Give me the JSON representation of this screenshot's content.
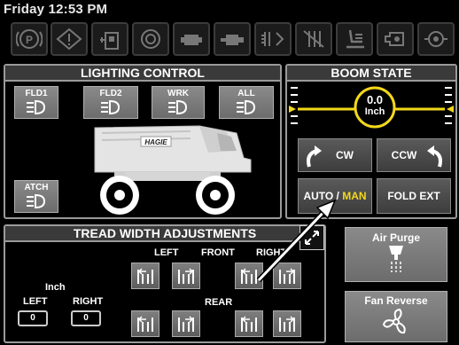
{
  "status": {
    "datetime": "Friday 12:53 PM"
  },
  "indicators": [
    {
      "icon": "parking-brake-icon",
      "label": "(P)"
    },
    {
      "icon": "warning-icon",
      "label": "!"
    },
    {
      "icon": "fuel-tank-icon"
    },
    {
      "icon": "engine-oil-icon"
    },
    {
      "icon": "battery-icon"
    },
    {
      "icon": "oil-can-icon"
    },
    {
      "icon": "heater-icon"
    },
    {
      "icon": "filter-restriction-icon"
    },
    {
      "icon": "seat-icon"
    },
    {
      "icon": "pump-icon"
    },
    {
      "icon": "hydraulic-icon"
    }
  ],
  "lighting": {
    "title": "LIGHTING CONTROL",
    "buttons": {
      "fld1": "FLD1",
      "fld2": "FLD2",
      "wrk": "WRK",
      "all": "ALL",
      "atch": "ATCH"
    },
    "machine_badge": "HAGIE"
  },
  "boom": {
    "title": "BOOM STATE",
    "value": "0.0",
    "unit": "Inch",
    "cw": "CW",
    "ccw": "CCW",
    "auto": "AUTO",
    "separator": " / ",
    "man": "MAN",
    "fold_ext": "FOLD EXT"
  },
  "tread": {
    "title": "TREAD WIDTH ADJUSTMENTS",
    "left_head": "LEFT",
    "front": "FRONT",
    "right_head": "RIGHT",
    "rear": "REAR",
    "unit": "Inch",
    "left_label": "LEFT",
    "right_label": "RIGHT",
    "left_value": "0",
    "right_value": "0"
  },
  "side": {
    "air_purge": "Air Purge",
    "fan_reverse": "Fan Reverse"
  },
  "colors": {
    "accent_yellow": "#f3d81b",
    "panel_border": "#9a9a9a",
    "button_gray": "#7a7a7a"
  }
}
